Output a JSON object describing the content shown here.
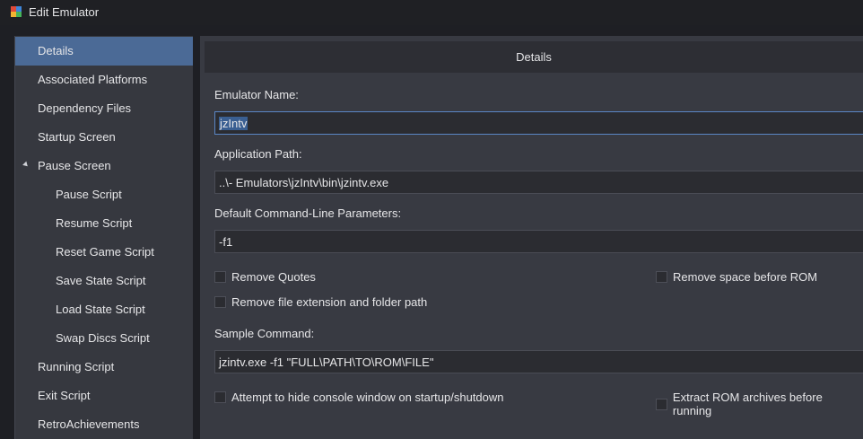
{
  "window": {
    "title": "Edit Emulator"
  },
  "sidebar": {
    "items": [
      {
        "label": "Details",
        "selected": true
      },
      {
        "label": "Associated Platforms"
      },
      {
        "label": "Dependency Files"
      },
      {
        "label": "Startup Screen"
      },
      {
        "label": "Pause Screen",
        "expanded": true
      },
      {
        "label": "Pause Script"
      },
      {
        "label": "Resume Script"
      },
      {
        "label": "Reset Game Script"
      },
      {
        "label": "Save State Script"
      },
      {
        "label": "Load State Script"
      },
      {
        "label": "Swap Discs Script"
      },
      {
        "label": "Running Script"
      },
      {
        "label": "Exit Script"
      },
      {
        "label": "RetroAchievements"
      }
    ]
  },
  "details": {
    "header": "Details",
    "emulator_name_label": "Emulator Name:",
    "emulator_name_value": "jzIntv",
    "app_path_label": "Application Path:",
    "app_path_value": "..\\- Emulators\\jzIntv\\bin\\jzintv.exe",
    "cmdline_label": "Default Command-Line Parameters:",
    "cmdline_value": "-f1",
    "remove_quotes": "Remove Quotes",
    "remove_space": "Remove space before ROM",
    "remove_ext": "Remove file extension and folder path",
    "sample_label": "Sample Command:",
    "sample_value": "jzintv.exe -f1 \"FULL\\PATH\\TO\\ROM\\FILE\"",
    "hide_console": "Attempt to hide console window on startup/shutdown",
    "extract_rom": "Extract ROM archives before running"
  },
  "colors": {
    "selection": "#4b6a96",
    "background": "#1e1f24",
    "panel": "#383a42"
  }
}
